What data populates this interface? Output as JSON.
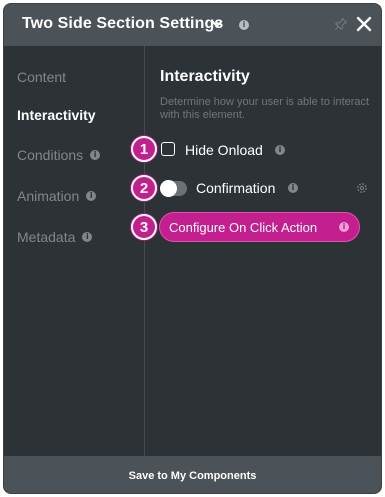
{
  "header": {
    "title": "Two Side Section Settings",
    "info_glyph": "i",
    "icons": [
      "chevron-down-icon",
      "info-icon",
      "pin-icon",
      "close-icon"
    ]
  },
  "sidebar": {
    "items": [
      {
        "label": "Content",
        "active": false,
        "has_info": false
      },
      {
        "label": "Interactivity",
        "active": true,
        "has_info": false
      },
      {
        "label": "Conditions",
        "active": false,
        "has_info": true
      },
      {
        "label": "Animation",
        "active": false,
        "has_info": true
      },
      {
        "label": "Metadata",
        "active": false,
        "has_info": true
      }
    ]
  },
  "main": {
    "title": "Interactivity",
    "description": "Determine how your user is able to interact with this element.",
    "badges": [
      "1",
      "2",
      "3"
    ],
    "hide_onload": {
      "label": "Hide Onload",
      "checked": false
    },
    "confirmation": {
      "label": "Confirmation",
      "enabled": false
    },
    "action_button": {
      "label": "Configure On Click Action"
    }
  },
  "footer": {
    "label": "Save to My Components"
  },
  "colors": {
    "panel_bg": "#2d3236",
    "header_bg": "#4b5358",
    "accent": "#c41f8f",
    "muted_text": "#80878c"
  }
}
